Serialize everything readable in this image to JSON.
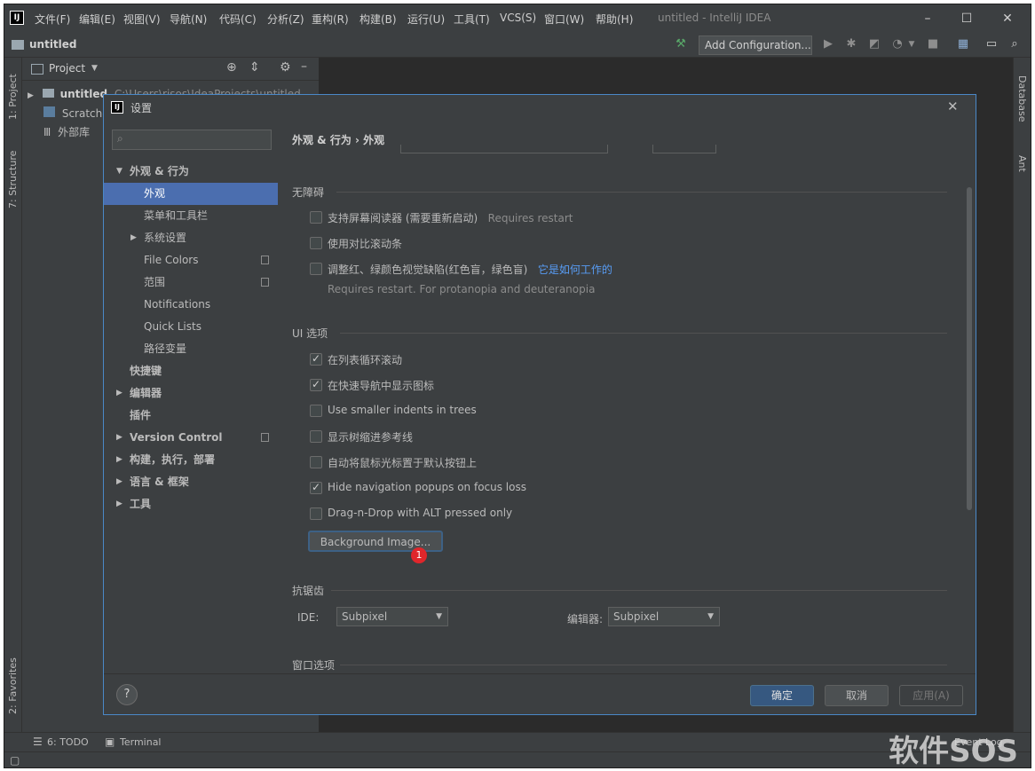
{
  "titlebar": {
    "menus": [
      "文件(F)",
      "编辑(E)",
      "视图(V)",
      "导航(N)",
      "代码(C)",
      "分析(Z)",
      "重构(R)",
      "构建(B)",
      "运行(U)",
      "工具(T)",
      "VCS(S)",
      "窗口(W)",
      "帮助(H)"
    ],
    "window_title": "untitled - IntelliJ IDEA"
  },
  "navbar": {
    "project_name": "untitled",
    "add_configuration": "Add Configuration..."
  },
  "left_strip": {
    "project_tab": "1: Project",
    "structure_tab": "7: Structure",
    "favorites_tab": "2: Favorites"
  },
  "right_strip": {
    "database_tab": "Database",
    "ant_tab": "Ant"
  },
  "project_panel": {
    "title": "Project",
    "tree": {
      "root_name": "untitled",
      "root_path": "C:\\Users\\risos\\IdeaProjects\\untitled",
      "scratches": "Scratches",
      "external_libs": "外部库"
    }
  },
  "bottom_tools": {
    "todo": "6: TODO",
    "terminal": "Terminal",
    "event_log": "Event Log"
  },
  "dialog": {
    "title": "设置",
    "breadcrumb": "外观 & 行为 › 外观",
    "sidebar": [
      {
        "label": "外观 & 行为",
        "level": 0,
        "expanded": true,
        "bold": true
      },
      {
        "label": "外观",
        "level": 1,
        "selected": true
      },
      {
        "label": "菜单和工具栏",
        "level": 1
      },
      {
        "label": "系统设置",
        "level": 1,
        "collapsed": true
      },
      {
        "label": "File Colors",
        "level": 1,
        "copy": true
      },
      {
        "label": "范围",
        "level": 1,
        "copy": true
      },
      {
        "label": "Notifications",
        "level": 1
      },
      {
        "label": "Quick Lists",
        "level": 1
      },
      {
        "label": "路径变量",
        "level": 1
      },
      {
        "label": "快捷键",
        "level": 0,
        "bold": true
      },
      {
        "label": "编辑器",
        "level": 0,
        "collapsed": true,
        "bold": true
      },
      {
        "label": "插件",
        "level": 0,
        "bold": true
      },
      {
        "label": "Version Control",
        "level": 0,
        "collapsed": true,
        "bold": true,
        "copy": true
      },
      {
        "label": "构建，执行，部署",
        "level": 0,
        "collapsed": true,
        "bold": true
      },
      {
        "label": "语言 & 框架",
        "level": 0,
        "collapsed": true,
        "bold": true
      },
      {
        "label": "工具",
        "level": 0,
        "collapsed": true,
        "bold": true
      }
    ],
    "accessibility": {
      "title": "无障碍",
      "screen_reader": "支持屏幕阅读器 (需要重新启动)",
      "screen_reader_hint": "Requires restart",
      "contrast_scrollbars": "使用对比滚动条",
      "color_deficiency": "调整红、绿颜色视觉缺陷(红色盲，绿色盲)",
      "color_deficiency_link": "它是如何工作的",
      "color_deficiency_hint": "Requires restart. For protanopia and deuteranopia"
    },
    "ui_options": {
      "title": "UI 选项",
      "items": [
        {
          "label": "在列表循环滚动",
          "checked": true
        },
        {
          "label": "在快速导航中显示图标",
          "checked": true
        },
        {
          "label": "Use smaller indents in trees",
          "checked": false
        },
        {
          "label": "显示树缩进参考线",
          "checked": false
        },
        {
          "label": "自动将鼠标光标置于默认按钮上",
          "checked": false
        },
        {
          "label": "Hide navigation popups on focus loss",
          "checked": true
        },
        {
          "label": "Drag-n-Drop with ALT pressed only",
          "checked": false
        }
      ],
      "background_image_button": "Background Image...",
      "badge": "1"
    },
    "antialiasing": {
      "title": "抗锯齿",
      "ide_label": "IDE:",
      "ide_value": "Subpixel",
      "editor_label": "编辑器:",
      "editor_value": "Subpixel"
    },
    "window_options_title": "窗口选项",
    "footer": {
      "help": "?",
      "ok": "确定",
      "cancel": "取消",
      "apply": "应用(A)"
    }
  },
  "watermark": "软件SOS"
}
